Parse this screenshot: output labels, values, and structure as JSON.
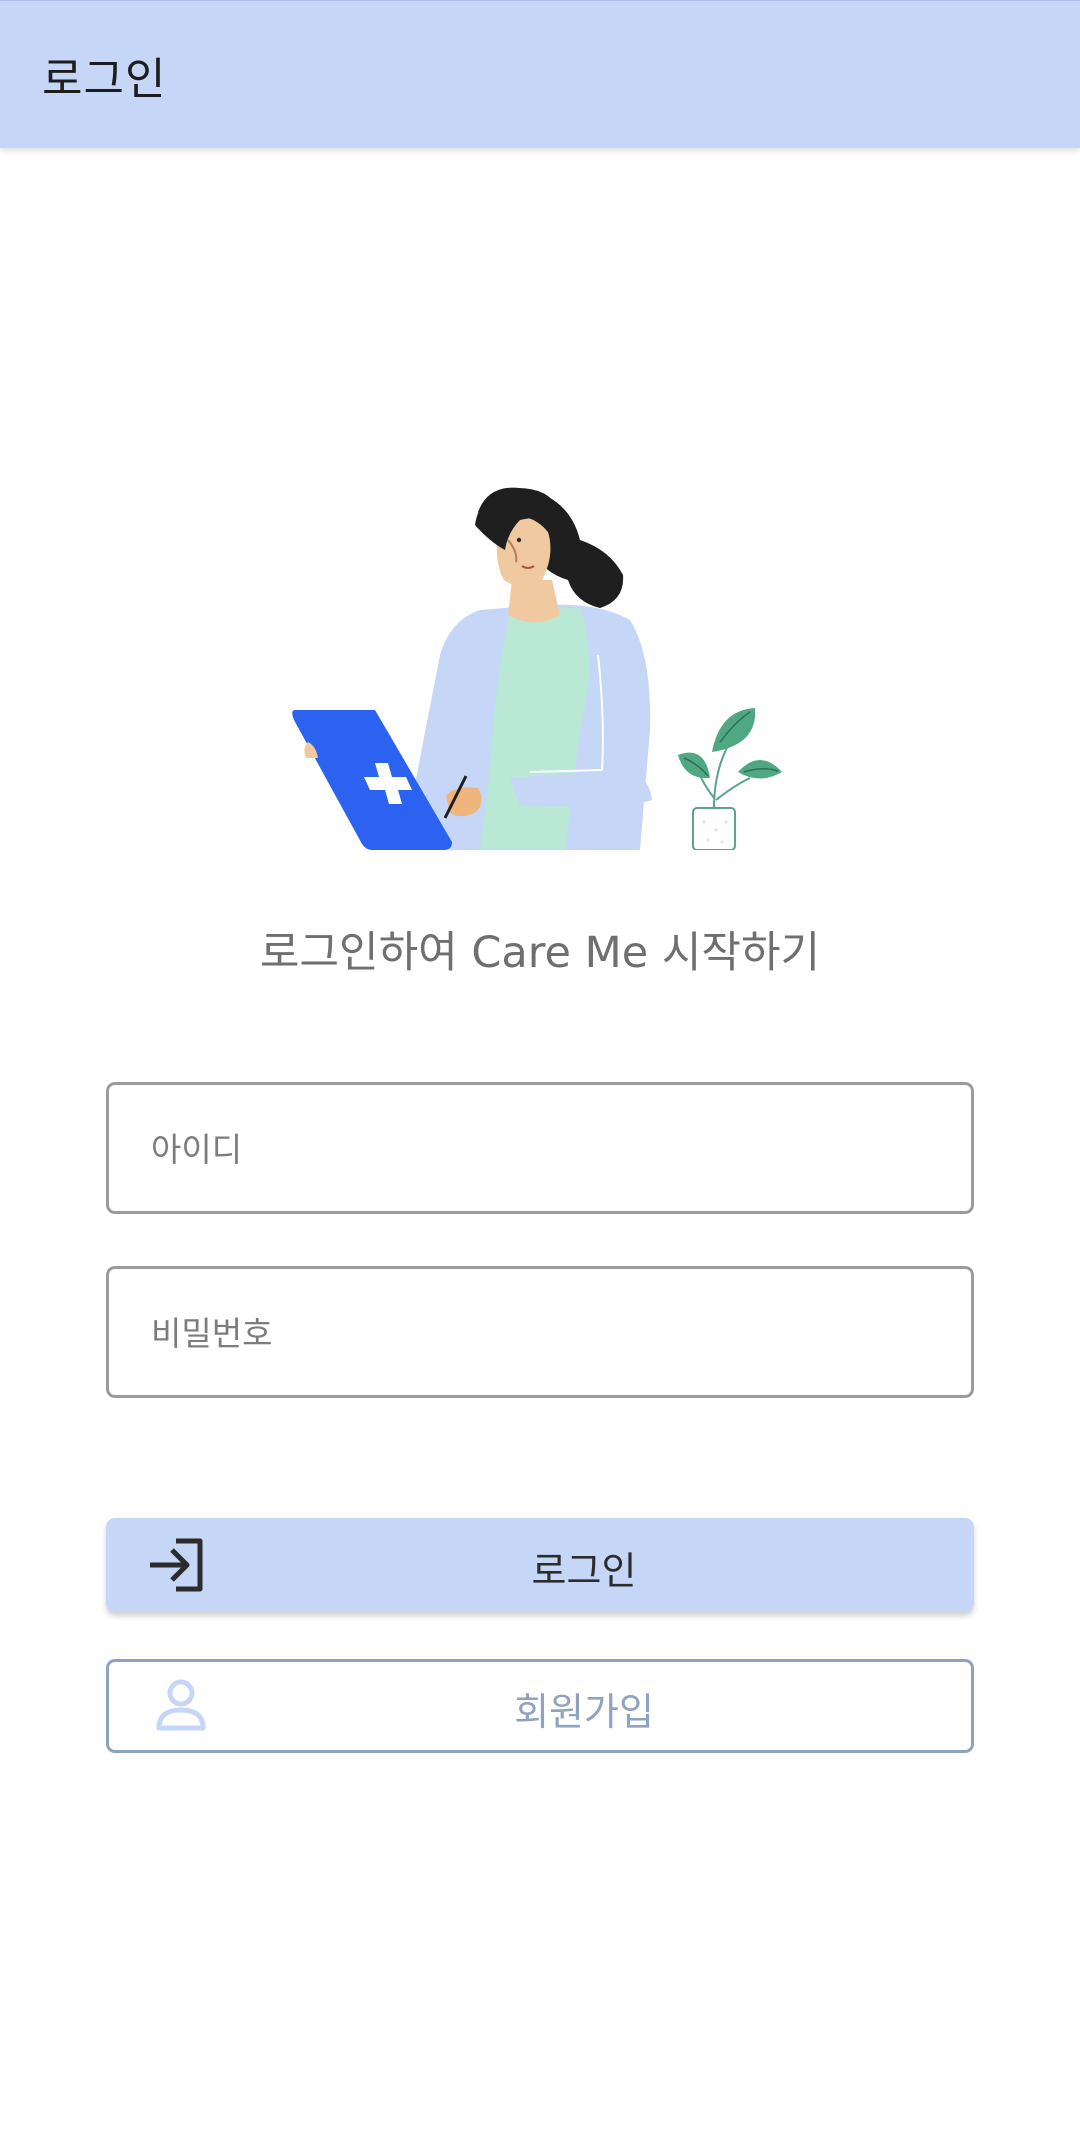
{
  "app_bar": {
    "title": "로그인"
  },
  "hero": {
    "tagline": "로그인하여 Care Me 시작하기"
  },
  "form": {
    "id_placeholder": "아이디",
    "password_placeholder": "비밀번호"
  },
  "buttons": {
    "login_label": "로그인",
    "login_icon": "login-icon",
    "signup_label": "회원가입",
    "signup_icon": "person-icon"
  },
  "colors": {
    "app_bar": "#c5d6f7",
    "login_button": "#c5d6f7",
    "signup_border": "#8fa2bf",
    "tablet": "#2b63f0"
  }
}
